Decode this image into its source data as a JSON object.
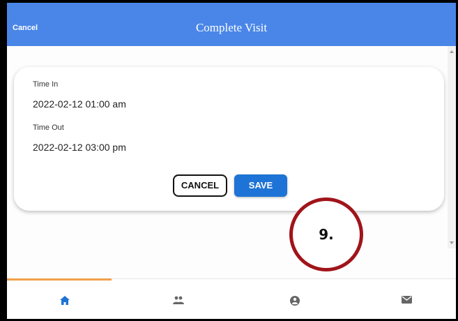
{
  "header": {
    "cancel_label": "Cancel",
    "title": "Complete Visit",
    "color": "#4a86e8"
  },
  "form": {
    "time_in_label": "Time In",
    "time_in_value": "2022-02-12 01:00 am",
    "time_out_label": "Time Out",
    "time_out_value": "2022-02-12 03:00 pm",
    "cancel_button": "CANCEL",
    "save_button": "SAVE",
    "save_color": "#1e73d6"
  },
  "annotation": {
    "step_label": "9.",
    "ring_color": "#a0141a"
  },
  "tabbar": {
    "active_indicator_color": "#f0a04b",
    "tabs": [
      {
        "icon": "home-icon",
        "active": true,
        "color": "#1e73d6"
      },
      {
        "icon": "people-icon",
        "active": false
      },
      {
        "icon": "account-icon",
        "active": false
      },
      {
        "icon": "mail-icon",
        "active": false
      }
    ]
  }
}
